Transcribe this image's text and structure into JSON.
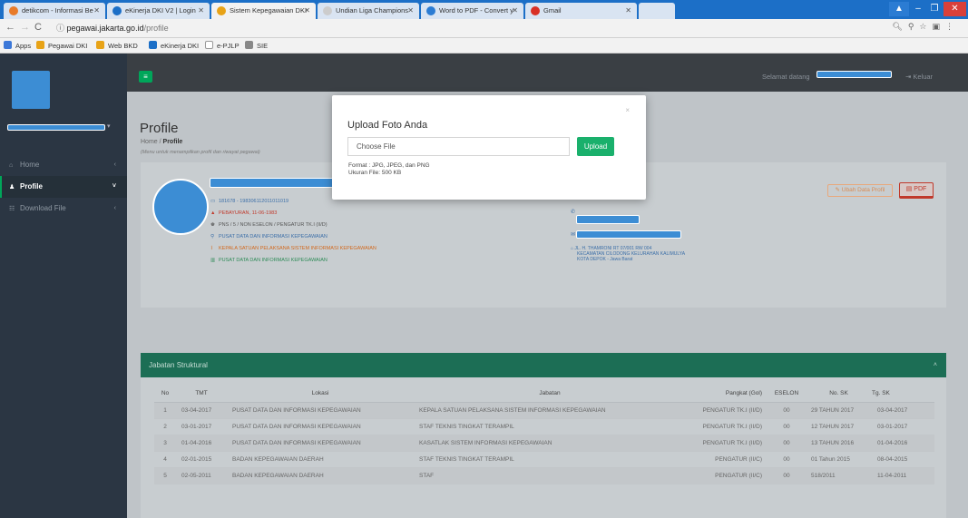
{
  "browser": {
    "tabs": [
      {
        "title": "detikcom - Informasi Be",
        "color": "#e87b2a"
      },
      {
        "title": "eKinerja DKI V2 | Login",
        "color": "#1c6fc7"
      },
      {
        "title": "Sistem Kepegawaian DKI",
        "color": "#e8a317",
        "active": true
      },
      {
        "title": "Undian Liga Champions",
        "color": "#cccccc"
      },
      {
        "title": "Word to PDF - Convert y",
        "color": "#2b7cd3"
      },
      {
        "title": "Gmail",
        "color": "#d93025"
      }
    ],
    "url_host": "pegawai.jakarta.go.id",
    "url_path": "/profile",
    "bookmarks": [
      {
        "label": "Apps",
        "color": "#3c78d8"
      },
      {
        "label": "Pegawai DKI",
        "color": "#e8a317"
      },
      {
        "label": "Web BKD",
        "color": "#e8a317"
      },
      {
        "label": "eKinerja DKI",
        "color": "#1c6fc7"
      },
      {
        "label": "e-PJLP",
        "color": "#999999"
      },
      {
        "label": "SIE",
        "color": "#888888"
      }
    ]
  },
  "sidebar": {
    "items": [
      {
        "label": "Home",
        "icon": "home-icon"
      },
      {
        "label": "Profile",
        "icon": "user-icon",
        "active": true
      },
      {
        "label": "Download File",
        "icon": "grid-icon"
      }
    ]
  },
  "topbar": {
    "welcome": "Selamat datang",
    "logout": "Keluar"
  },
  "page": {
    "title": "Profile",
    "breadcrumb_home": "Home",
    "breadcrumb_current": "Profile",
    "subtitle": "(Menu untuk menampilkan profil dan riwayat pegawai)"
  },
  "profile": {
    "nip": "181678 - 198306112011011019",
    "birth": "PEBAYURAN, 11-06-1983",
    "status": "PNS / 5 / NON ESELON / PENGATUR TK.I (II/D)",
    "unit": "PUSAT DATA DAN INFORMASI KEPEGAWAIAN",
    "jabatan": "KEPALA SATUAN PELAKSANA SISTEM INFORMASI KEPEGAWAIAN",
    "unit2": "PUSAT DATA DAN INFORMASI KEPEGAWAIAN",
    "address_line1": "JL. H. THAMRONI RT 07/001 RW 004",
    "address_line2": "KECAMATAN CILODONG KELURAHAN KALIMULYA",
    "address_line3": "KOTA DEPOK - Jawa Barat",
    "edit_button": "Ubah Data Profil",
    "pdf_button": "PDF"
  },
  "jabatan_section": {
    "title": "Jabatan Struktural",
    "columns": [
      "No",
      "TMT",
      "Lokasi",
      "Jabatan",
      "Pangkat (Gol)",
      "ESELON",
      "No. SK",
      "Tg. SK"
    ],
    "rows": [
      [
        "1",
        "03-04-2017",
        "PUSAT DATA DAN INFORMASI KEPEGAWAIAN",
        "KEPALA SATUAN PELAKSANA SISTEM INFORMASI KEPEGAWAIAN",
        "PENGATUR TK.I (II/D)",
        "00",
        "29 TAHUN 2017",
        "03-04-2017"
      ],
      [
        "2",
        "03-01-2017",
        "PUSAT DATA DAN INFORMASI KEPEGAWAIAN",
        "STAF TEKNIS TINGKAT TERAMPIL",
        "PENGATUR TK.I (II/D)",
        "00",
        "12 TAHUN 2017",
        "03-01-2017"
      ],
      [
        "3",
        "01-04-2016",
        "PUSAT DATA DAN INFORMASI KEPEGAWAIAN",
        "KASATLAK SISTEM INFORMASI KEPEGAWAIAN",
        "PENGATUR TK.I (II/D)",
        "00",
        "13 TAHUN 2016",
        "01-04-2016"
      ],
      [
        "4",
        "02-01-2015",
        "BADAN KEPEGAWAIAN DAERAH",
        "STAF TEKNIS TINGKAT TERAMPIL",
        "PENGATUR (II/C)",
        "00",
        "01 Tahun 2015",
        "08-04-2015"
      ],
      [
        "5",
        "02-05-2011",
        "BADAN KEPEGAWAIAN DAERAH",
        "STAF",
        "PENGATUR (II/C)",
        "00",
        "518/2011",
        "11-04-2011"
      ]
    ]
  },
  "modal": {
    "title": "Upload Foto Anda",
    "file_placeholder": "Choose File",
    "upload_button": "Upload",
    "format_note": "Format : JPG, JPEG, dan PNG",
    "size_note": "Ukuran File: 500 KB"
  }
}
